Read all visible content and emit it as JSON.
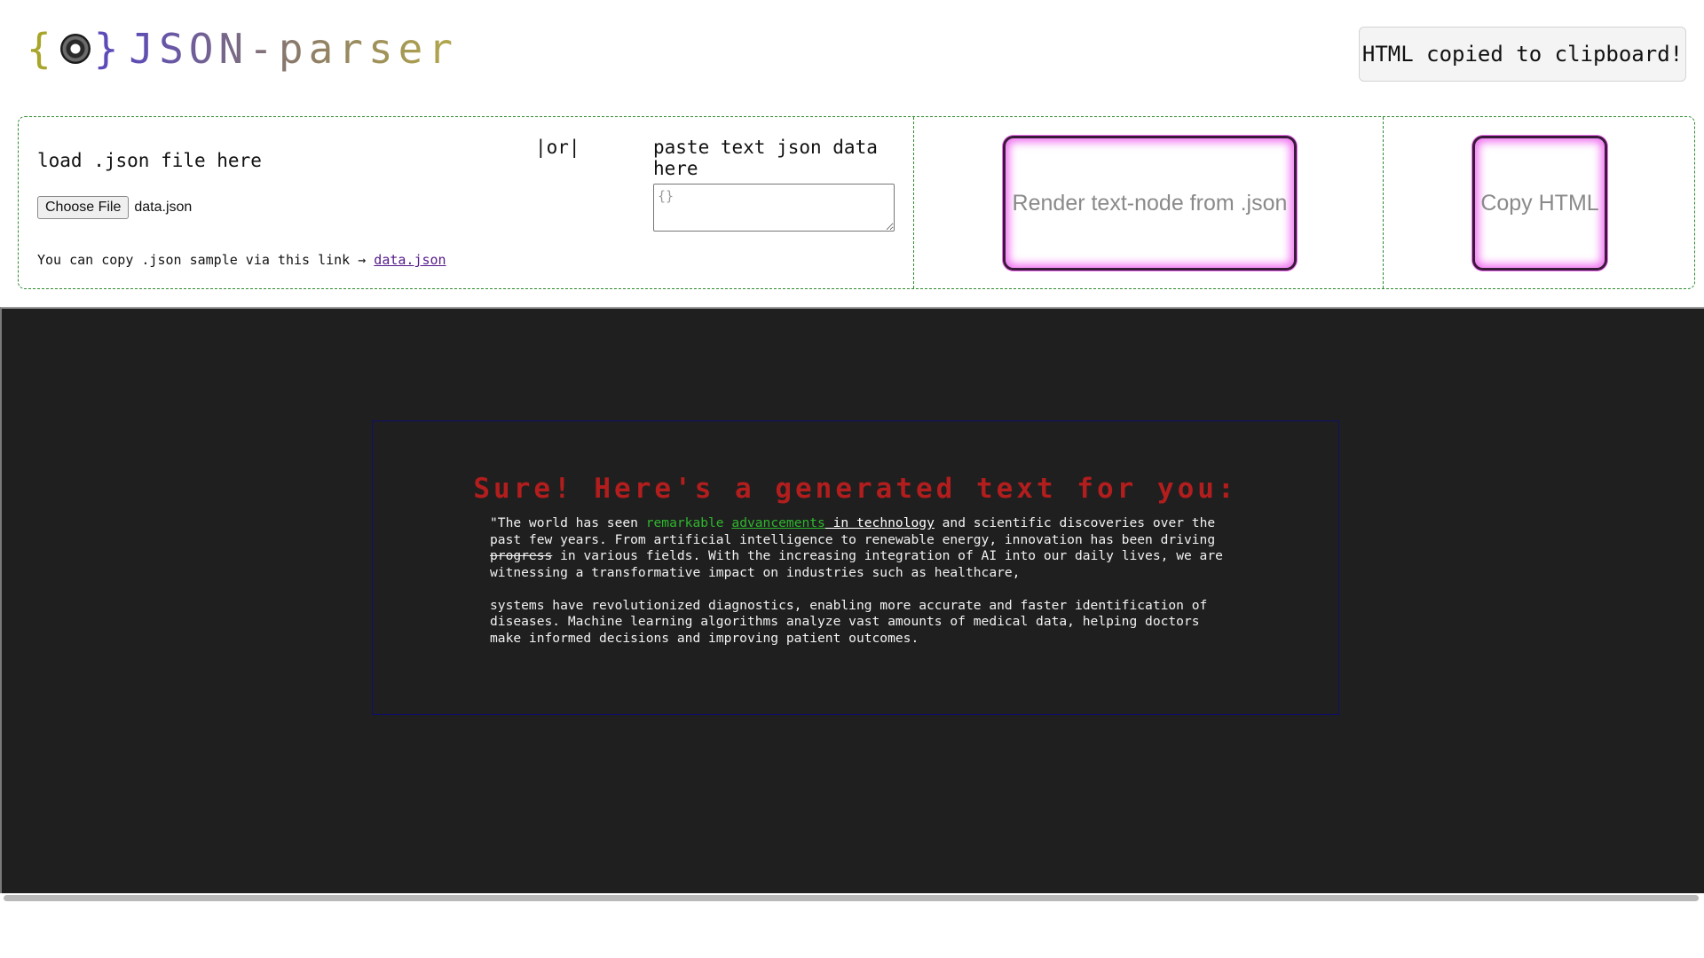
{
  "app": {
    "logo_left_brace": "{",
    "logo_right_brace": "}",
    "logo_name": "JSON-parser"
  },
  "toast": {
    "message": "HTML copied to clipboard!"
  },
  "loader": {
    "load_label": "load .json file here",
    "or_label": "|or|",
    "paste_label": "paste text json data here",
    "choose_file_label": "Choose File",
    "chosen_file": "data.json",
    "textarea_placeholder": "{}",
    "sample_prefix": "You can copy .json sample via this link → ",
    "sample_link": "data.json"
  },
  "actions": {
    "render_label": "Render text-node from .json",
    "copy_label": "Copy HTML"
  },
  "output": {
    "title": "Sure! Here's a generated text for you:",
    "p1_a": "\"The world has seen ",
    "p1_green": "remarkable",
    "p1_space": " ",
    "p1_green_u": "advancements",
    "p1_white_u": " in technology",
    "p1_b": " and scientific discoveries over the past few years. From artificial intelligence to renewable energy, innovation has been driving ",
    "p1_strike": "progress",
    "p1_c": " in various fields. With the increasing integration of AI into our daily lives, we are witnessing a transformative impact on industries such as healthcare,",
    "p2": "systems have revolutionized diagnostics, enabling more accurate and faster identification of diseases. Machine learning algorithms analyze vast amounts of medical data, helping doctors make informed decisions and improving patient outcomes."
  },
  "colors": {
    "panel_border": "#2e8b2e",
    "output_bg": "#1f1f1f",
    "title_red": "#b21d1d",
    "highlight_green": "#2fb52f",
    "button_glow": "#f070f0"
  }
}
